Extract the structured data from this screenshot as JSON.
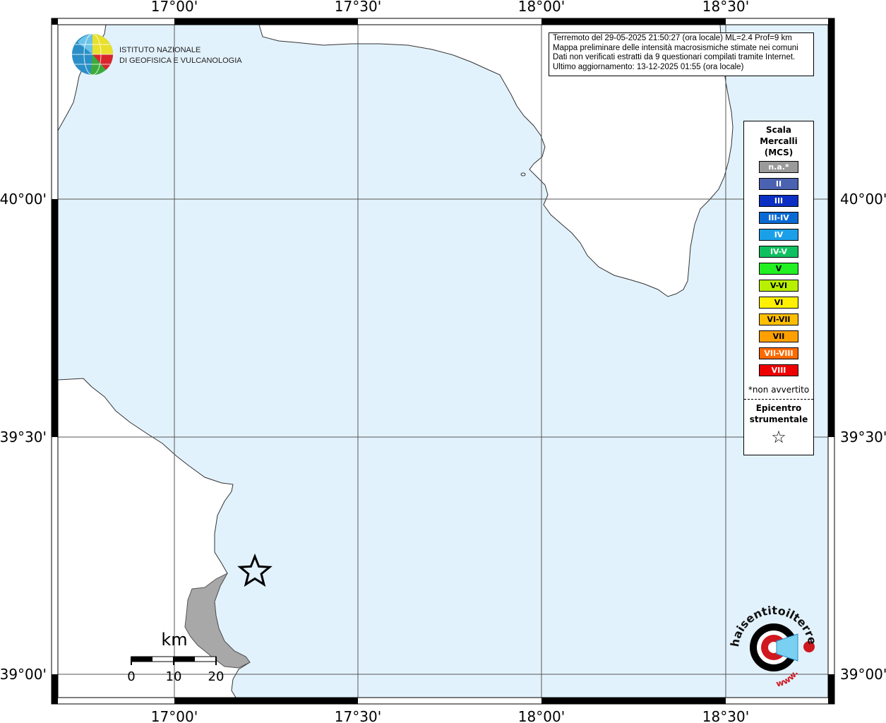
{
  "logo": {
    "line1": "ISTITUTO NAZIONALE",
    "line2": "DI GEOFISICA E VULCANOLOGIA"
  },
  "info": {
    "line1": "Terremoto del 29-05-2025 21:50:27 (ora locale) ML=2.4 Prof=9 km",
    "line2": "Mappa preliminare delle intensità macrosismiche stimate nei comuni",
    "line3": "Dati non verificati estratti da 9 questionari compilati tramite Internet.",
    "line4": "Ultimo aggiornamento: 13-12-2025 01:55 (ora locale)"
  },
  "axes": {
    "longitude_labels": [
      "17°00'",
      "17°30'",
      "18°00'",
      "18°30'"
    ],
    "latitude_labels": [
      "40°00'",
      "39°30'",
      "39°00'"
    ]
  },
  "legend": {
    "title_line1": "Scala",
    "title_line2": "Mercalli",
    "title_line3": "(MCS)",
    "items": [
      {
        "label": "n.a.*",
        "color": "#9a9a9a"
      },
      {
        "label": "II",
        "color": "#4a62b0"
      },
      {
        "label": "III",
        "color": "#0b2fc2"
      },
      {
        "label": "III-IV",
        "color": "#0a6ad4"
      },
      {
        "label": "IV",
        "color": "#1aa0e8"
      },
      {
        "label": "IV-V",
        "color": "#0fc060"
      },
      {
        "label": "V",
        "color": "#22f022"
      },
      {
        "label": "V-VI",
        "color": "#b8f000"
      },
      {
        "label": "VI",
        "color": "#fff000"
      },
      {
        "label": "VI-VII",
        "color": "#ffbe00"
      },
      {
        "label": "VII",
        "color": "#ffa000"
      },
      {
        "label": "VII-VIII",
        "color": "#ff6a00"
      },
      {
        "label": "VIII",
        "color": "#ee0000"
      }
    ],
    "note": "*non avvertito",
    "epicenter_line1": "Epicentro",
    "epicenter_line2": "strumentale",
    "epicenter_symbol": "☆"
  },
  "scale_bar": {
    "unit": "km",
    "labels": [
      "0",
      "10",
      "20"
    ]
  },
  "brand_logo": {
    "text": "haisentitoilterremoto.it",
    "prefix": "www."
  },
  "colors": {
    "sea": "#e2f2fd",
    "land": "#ffffff",
    "felt_area": "#a8a8a8"
  }
}
